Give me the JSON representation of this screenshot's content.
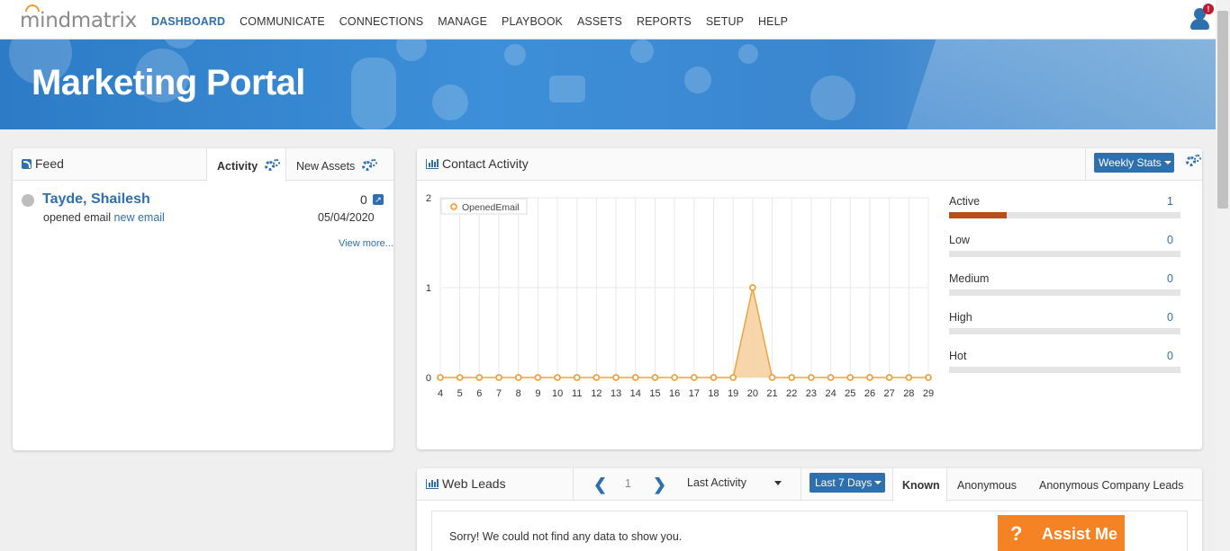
{
  "brand": {
    "logo": "mindmatrix"
  },
  "nav": [
    {
      "label": "DASHBOARD",
      "active": true
    },
    {
      "label": "COMMUNICATE",
      "active": false
    },
    {
      "label": "CONNECTIONS",
      "active": false
    },
    {
      "label": "MANAGE",
      "active": false
    },
    {
      "label": "PLAYBOOK",
      "active": false
    },
    {
      "label": "ASSETS",
      "active": false
    },
    {
      "label": "REPORTS",
      "active": false
    },
    {
      "label": "SETUP",
      "active": false
    },
    {
      "label": "HELP",
      "active": false
    }
  ],
  "user": {
    "badge": "!"
  },
  "banner": {
    "title": "Marketing Portal"
  },
  "feed": {
    "title": "Feed",
    "tabs": {
      "activity": "Activity",
      "new_assets": "New Assets"
    },
    "item": {
      "name": "Tayde, Shailesh",
      "action": "opened email",
      "link": "new email",
      "count": "0",
      "date": "05/04/2020"
    },
    "view_more": "View more..."
  },
  "contact_activity": {
    "title": "Contact Activity",
    "weekly_stats": "Weekly Stats",
    "stats": [
      {
        "label": "Active",
        "value": "1",
        "fill": 0.25
      },
      {
        "label": "Low",
        "value": "0",
        "fill": 0
      },
      {
        "label": "Medium",
        "value": "0",
        "fill": 0
      },
      {
        "label": "High",
        "value": "0",
        "fill": 0
      },
      {
        "label": "Hot",
        "value": "0",
        "fill": 0
      }
    ]
  },
  "chart_data": {
    "type": "area",
    "x": [
      4,
      5,
      6,
      7,
      8,
      9,
      10,
      11,
      12,
      13,
      14,
      15,
      16,
      17,
      18,
      19,
      20,
      21,
      22,
      23,
      24,
      25,
      26,
      27,
      28,
      29
    ],
    "series": [
      {
        "name": "OpenedEmail",
        "values": [
          0,
          0,
          0,
          0,
          0,
          0,
          0,
          0,
          0,
          0,
          0,
          0,
          0,
          0,
          0,
          0,
          1,
          0,
          0,
          0,
          0,
          0,
          0,
          0,
          0,
          0
        ],
        "color": "#f0a33c"
      }
    ],
    "ylim": [
      0,
      2
    ],
    "yticks": [
      0,
      1,
      2
    ],
    "grid": true,
    "legend": "top-left"
  },
  "web_leads": {
    "title": "Web Leads",
    "page": "1",
    "sort": "Last Activity",
    "range": "Last 7 Days",
    "tabs": {
      "known": "Known",
      "anonymous": "Anonymous",
      "anonymous_company": "Anonymous Company Leads"
    },
    "empty_message": "Sorry! We could not find any data to show you."
  },
  "assist": {
    "label": "Assist Me",
    "icon": "?"
  }
}
